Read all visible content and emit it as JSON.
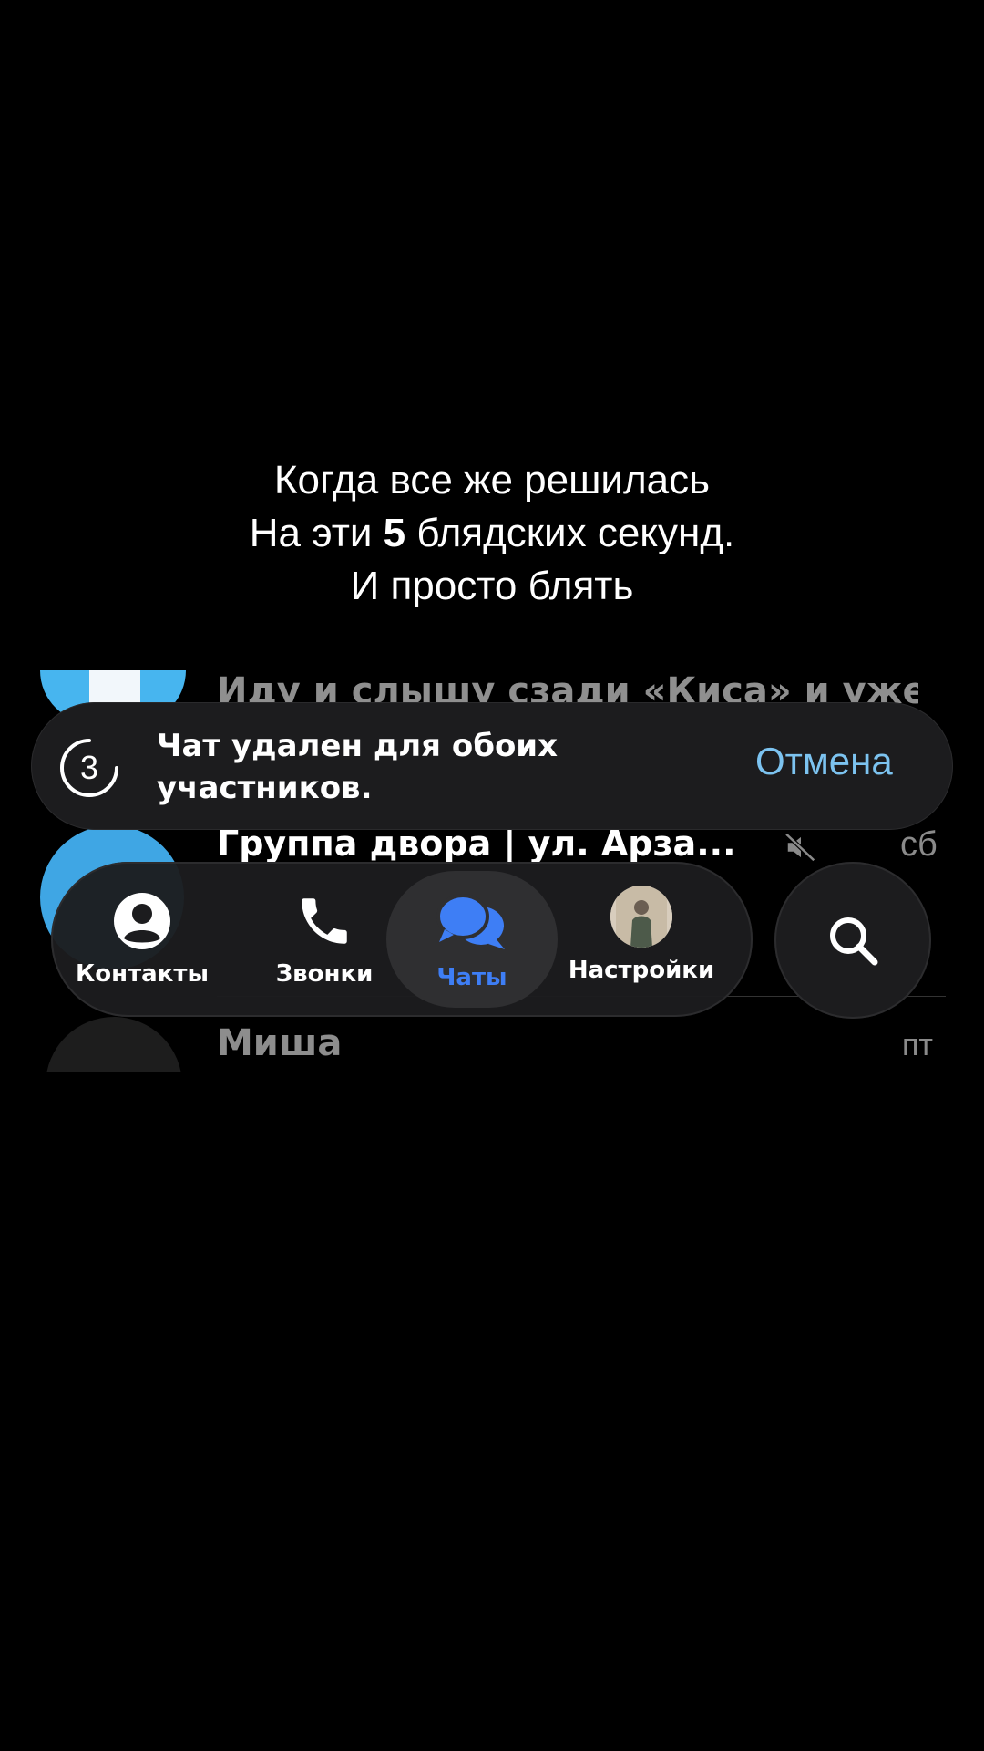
{
  "caption": {
    "line1": "Когда все же решилась",
    "line2_pre": "На эти ",
    "line2_bold": "5",
    "line2_post": " блядских секунд.",
    "line3": "И просто блять"
  },
  "chats": [
    {
      "title": "Иду и слышу сзади «Киса» и уже"
    },
    {
      "title": "Группа двора | ул. Арза...",
      "date": "сб",
      "muted": true
    },
    {
      "title": "Миша",
      "date": "пт"
    }
  ],
  "toast": {
    "countdown": "3",
    "message": "Чат удален для обоих участников.",
    "undo_label": "Отмена"
  },
  "tabbar": {
    "tabs": [
      {
        "label": "Контакты",
        "icon": "person-circle-icon"
      },
      {
        "label": "Звонки",
        "icon": "phone-icon"
      },
      {
        "label": "Чаты",
        "icon": "chat-bubbles-icon",
        "active": true
      },
      {
        "label": "Настройки",
        "icon": "avatar"
      }
    ]
  },
  "colors": {
    "background": "#000000",
    "accent": "#3e7ef5",
    "undo": "#7cc3f0",
    "toast_bg": "#1c1c1e"
  }
}
